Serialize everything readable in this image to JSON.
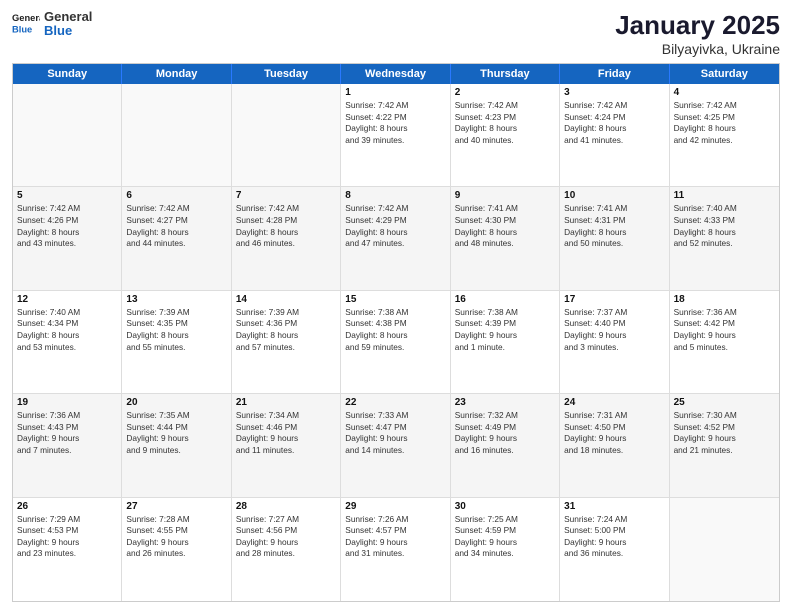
{
  "header": {
    "logo": {
      "line1": "General",
      "line2": "Blue"
    },
    "title": "January 2025",
    "subtitle": "Bilyayivka, Ukraine"
  },
  "weekdays": [
    "Sunday",
    "Monday",
    "Tuesday",
    "Wednesday",
    "Thursday",
    "Friday",
    "Saturday"
  ],
  "rows": [
    [
      {
        "day": "",
        "lines": [],
        "empty": true
      },
      {
        "day": "",
        "lines": [],
        "empty": true
      },
      {
        "day": "",
        "lines": [],
        "empty": true
      },
      {
        "day": "1",
        "lines": [
          "Sunrise: 7:42 AM",
          "Sunset: 4:22 PM",
          "Daylight: 8 hours",
          "and 39 minutes."
        ]
      },
      {
        "day": "2",
        "lines": [
          "Sunrise: 7:42 AM",
          "Sunset: 4:23 PM",
          "Daylight: 8 hours",
          "and 40 minutes."
        ]
      },
      {
        "day": "3",
        "lines": [
          "Sunrise: 7:42 AM",
          "Sunset: 4:24 PM",
          "Daylight: 8 hours",
          "and 41 minutes."
        ]
      },
      {
        "day": "4",
        "lines": [
          "Sunrise: 7:42 AM",
          "Sunset: 4:25 PM",
          "Daylight: 8 hours",
          "and 42 minutes."
        ]
      }
    ],
    [
      {
        "day": "5",
        "lines": [
          "Sunrise: 7:42 AM",
          "Sunset: 4:26 PM",
          "Daylight: 8 hours",
          "and 43 minutes."
        ]
      },
      {
        "day": "6",
        "lines": [
          "Sunrise: 7:42 AM",
          "Sunset: 4:27 PM",
          "Daylight: 8 hours",
          "and 44 minutes."
        ]
      },
      {
        "day": "7",
        "lines": [
          "Sunrise: 7:42 AM",
          "Sunset: 4:28 PM",
          "Daylight: 8 hours",
          "and 46 minutes."
        ]
      },
      {
        "day": "8",
        "lines": [
          "Sunrise: 7:42 AM",
          "Sunset: 4:29 PM",
          "Daylight: 8 hours",
          "and 47 minutes."
        ]
      },
      {
        "day": "9",
        "lines": [
          "Sunrise: 7:41 AM",
          "Sunset: 4:30 PM",
          "Daylight: 8 hours",
          "and 48 minutes."
        ]
      },
      {
        "day": "10",
        "lines": [
          "Sunrise: 7:41 AM",
          "Sunset: 4:31 PM",
          "Daylight: 8 hours",
          "and 50 minutes."
        ]
      },
      {
        "day": "11",
        "lines": [
          "Sunrise: 7:40 AM",
          "Sunset: 4:33 PM",
          "Daylight: 8 hours",
          "and 52 minutes."
        ]
      }
    ],
    [
      {
        "day": "12",
        "lines": [
          "Sunrise: 7:40 AM",
          "Sunset: 4:34 PM",
          "Daylight: 8 hours",
          "and 53 minutes."
        ]
      },
      {
        "day": "13",
        "lines": [
          "Sunrise: 7:39 AM",
          "Sunset: 4:35 PM",
          "Daylight: 8 hours",
          "and 55 minutes."
        ]
      },
      {
        "day": "14",
        "lines": [
          "Sunrise: 7:39 AM",
          "Sunset: 4:36 PM",
          "Daylight: 8 hours",
          "and 57 minutes."
        ]
      },
      {
        "day": "15",
        "lines": [
          "Sunrise: 7:38 AM",
          "Sunset: 4:38 PM",
          "Daylight: 8 hours",
          "and 59 minutes."
        ]
      },
      {
        "day": "16",
        "lines": [
          "Sunrise: 7:38 AM",
          "Sunset: 4:39 PM",
          "Daylight: 9 hours",
          "and 1 minute."
        ]
      },
      {
        "day": "17",
        "lines": [
          "Sunrise: 7:37 AM",
          "Sunset: 4:40 PM",
          "Daylight: 9 hours",
          "and 3 minutes."
        ]
      },
      {
        "day": "18",
        "lines": [
          "Sunrise: 7:36 AM",
          "Sunset: 4:42 PM",
          "Daylight: 9 hours",
          "and 5 minutes."
        ]
      }
    ],
    [
      {
        "day": "19",
        "lines": [
          "Sunrise: 7:36 AM",
          "Sunset: 4:43 PM",
          "Daylight: 9 hours",
          "and 7 minutes."
        ]
      },
      {
        "day": "20",
        "lines": [
          "Sunrise: 7:35 AM",
          "Sunset: 4:44 PM",
          "Daylight: 9 hours",
          "and 9 minutes."
        ]
      },
      {
        "day": "21",
        "lines": [
          "Sunrise: 7:34 AM",
          "Sunset: 4:46 PM",
          "Daylight: 9 hours",
          "and 11 minutes."
        ]
      },
      {
        "day": "22",
        "lines": [
          "Sunrise: 7:33 AM",
          "Sunset: 4:47 PM",
          "Daylight: 9 hours",
          "and 14 minutes."
        ]
      },
      {
        "day": "23",
        "lines": [
          "Sunrise: 7:32 AM",
          "Sunset: 4:49 PM",
          "Daylight: 9 hours",
          "and 16 minutes."
        ]
      },
      {
        "day": "24",
        "lines": [
          "Sunrise: 7:31 AM",
          "Sunset: 4:50 PM",
          "Daylight: 9 hours",
          "and 18 minutes."
        ]
      },
      {
        "day": "25",
        "lines": [
          "Sunrise: 7:30 AM",
          "Sunset: 4:52 PM",
          "Daylight: 9 hours",
          "and 21 minutes."
        ]
      }
    ],
    [
      {
        "day": "26",
        "lines": [
          "Sunrise: 7:29 AM",
          "Sunset: 4:53 PM",
          "Daylight: 9 hours",
          "and 23 minutes."
        ]
      },
      {
        "day": "27",
        "lines": [
          "Sunrise: 7:28 AM",
          "Sunset: 4:55 PM",
          "Daylight: 9 hours",
          "and 26 minutes."
        ]
      },
      {
        "day": "28",
        "lines": [
          "Sunrise: 7:27 AM",
          "Sunset: 4:56 PM",
          "Daylight: 9 hours",
          "and 28 minutes."
        ]
      },
      {
        "day": "29",
        "lines": [
          "Sunrise: 7:26 AM",
          "Sunset: 4:57 PM",
          "Daylight: 9 hours",
          "and 31 minutes."
        ]
      },
      {
        "day": "30",
        "lines": [
          "Sunrise: 7:25 AM",
          "Sunset: 4:59 PM",
          "Daylight: 9 hours",
          "and 34 minutes."
        ]
      },
      {
        "day": "31",
        "lines": [
          "Sunrise: 7:24 AM",
          "Sunset: 5:00 PM",
          "Daylight: 9 hours",
          "and 36 minutes."
        ]
      },
      {
        "day": "",
        "lines": [],
        "empty": true
      }
    ]
  ]
}
